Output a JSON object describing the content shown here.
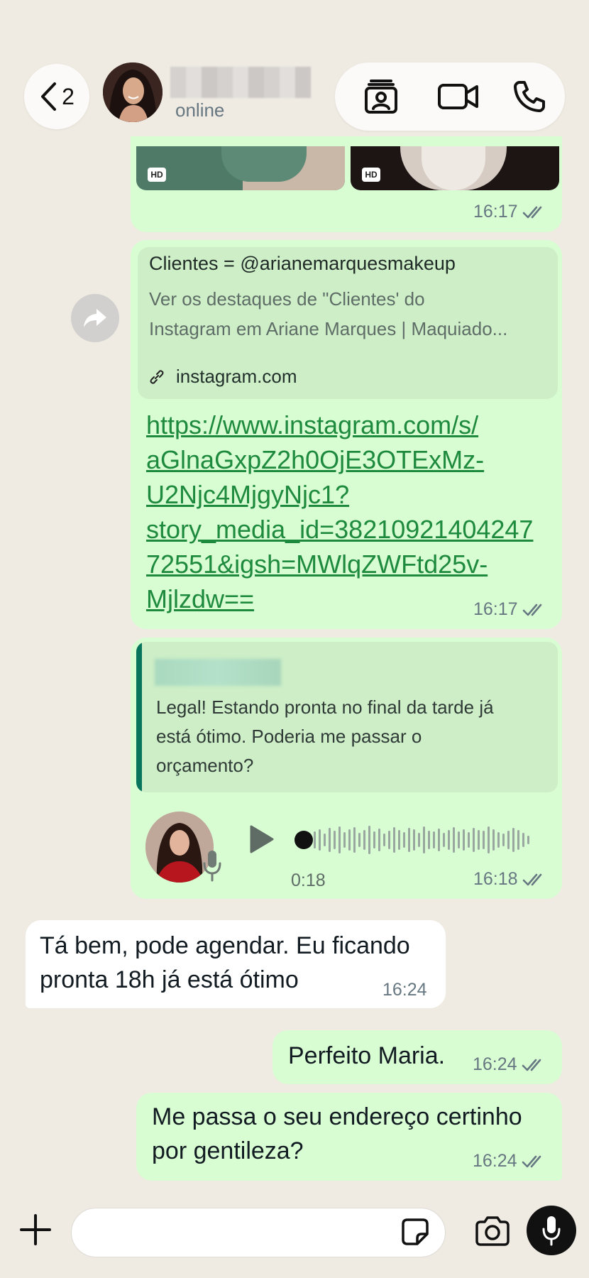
{
  "header": {
    "back_count": "2",
    "status": "online"
  },
  "messages": {
    "photo_time": "16:17",
    "preview_title": "Clientes = @arianemarquesmakeup",
    "preview_desc": [
      "Ver os destaques de \"Clientes' do",
      "Instagram em Ariane Marques | Maquiado..."
    ],
    "preview_domain": "instagram.com",
    "link_lines": [
      "https://www.instagram.com/s/",
      "aGlnaGxpZ2h0OjE3OTExMz-",
      "U2Njc4MjgyNjc1?",
      "story_media_id=38210921404247",
      "72551&igsh=MWlqZWFtd25v-",
      "Mjlzdw=="
    ],
    "link_time": "16:17",
    "quote_lines": [
      "Legal! Estando pronta no final da tarde já",
      "está ótimo. Poderia me passar o",
      "orçamento?"
    ],
    "voice_duration": "0:18",
    "voice_time": "16:18",
    "incoming_lines": [
      "Tá bem, pode agendar. Eu ficando",
      "pronta 18h já está ótimo"
    ],
    "incoming_time": "16:24",
    "out1_text": "Perfeito Maria.",
    "out1_time": "16:24",
    "out2_lines": [
      "Me passa o seu endereço certinho",
      "por gentileza?"
    ],
    "out2_time": "16:24"
  },
  "colors": {
    "background": "#efeae2",
    "outgoing_bubble": "#d9fdd3",
    "incoming_bubble": "#ffffff",
    "link": "#1d8a3d",
    "quote_bar": "#06755b"
  },
  "icons": [
    "back-chevron-icon",
    "contact-card-icon",
    "video-call-icon",
    "phone-icon",
    "forward-icon",
    "link-icon",
    "play-icon",
    "mic-icon",
    "plus-icon",
    "sticker-icon",
    "camera-icon",
    "read-ticks-icon"
  ]
}
